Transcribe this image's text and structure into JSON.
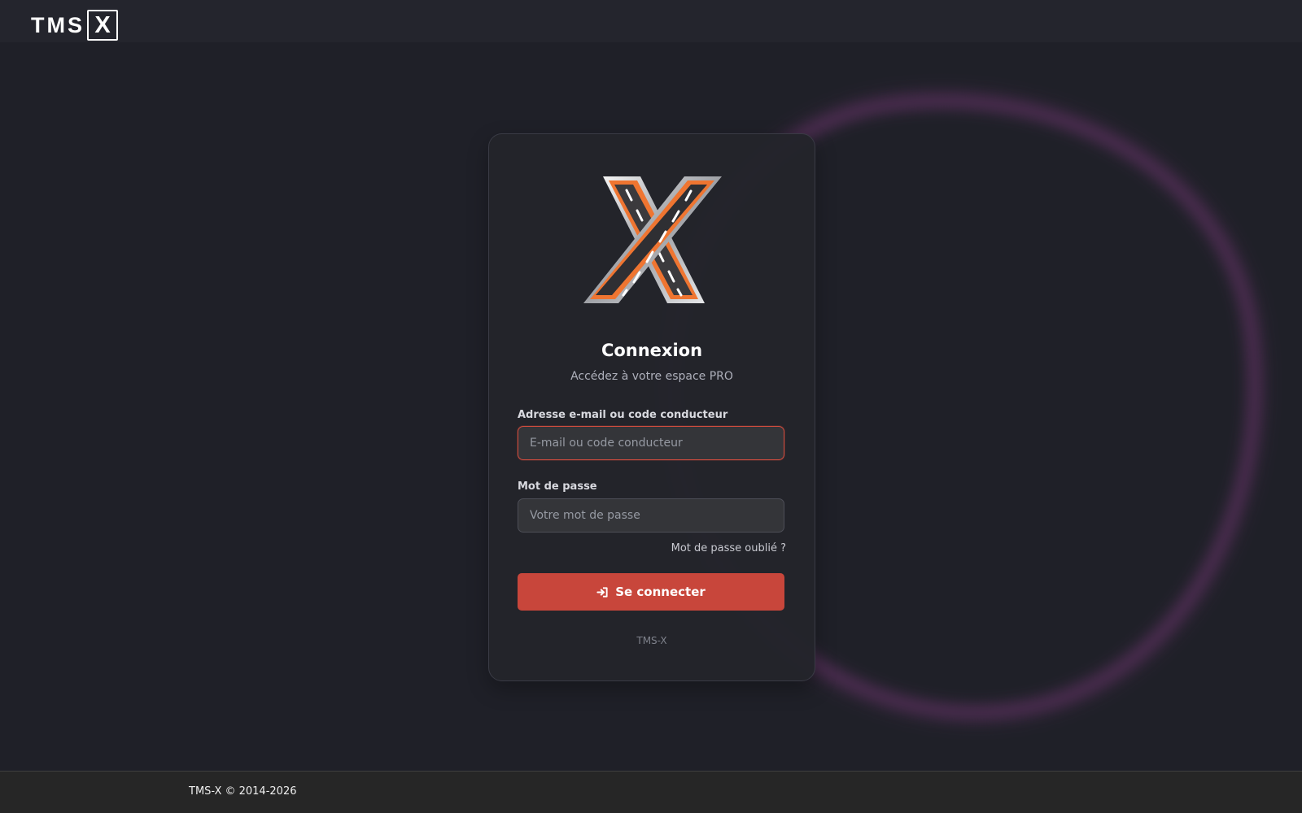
{
  "header": {
    "brand": {
      "main_text": "TMS",
      "boxed_text": "X",
      "icon": "tms-x-logo"
    }
  },
  "background": {
    "decoration": "purple-glow-ring",
    "accent_color": "#ae46a8"
  },
  "login_card": {
    "logo_icon": "road-x-logo-icon",
    "title": "Connexion",
    "subtitle": "Accédez à votre espace PRO",
    "email": {
      "label": "Adresse e-mail ou code conducteur",
      "value": "",
      "placeholder": "E-mail ou code conducteur",
      "border_color": "#d04c3e"
    },
    "password": {
      "label": "Mot de passe",
      "value": "",
      "placeholder": "Votre mot de passe"
    },
    "forgot_password_label": "Mot de passe oublié ?",
    "submit": {
      "label": "Se connecter",
      "icon": "sign-in-icon",
      "color": "#c8463b"
    },
    "footer_label": "TMS-X"
  },
  "footer": {
    "copyright": "TMS-X © 2014-2026"
  },
  "theme": {
    "page_background": "#1f2028",
    "card_background": "#23242b",
    "text_primary": "#ffffff",
    "text_muted": "#aeb0bb",
    "road_orange": "#ef7531"
  }
}
